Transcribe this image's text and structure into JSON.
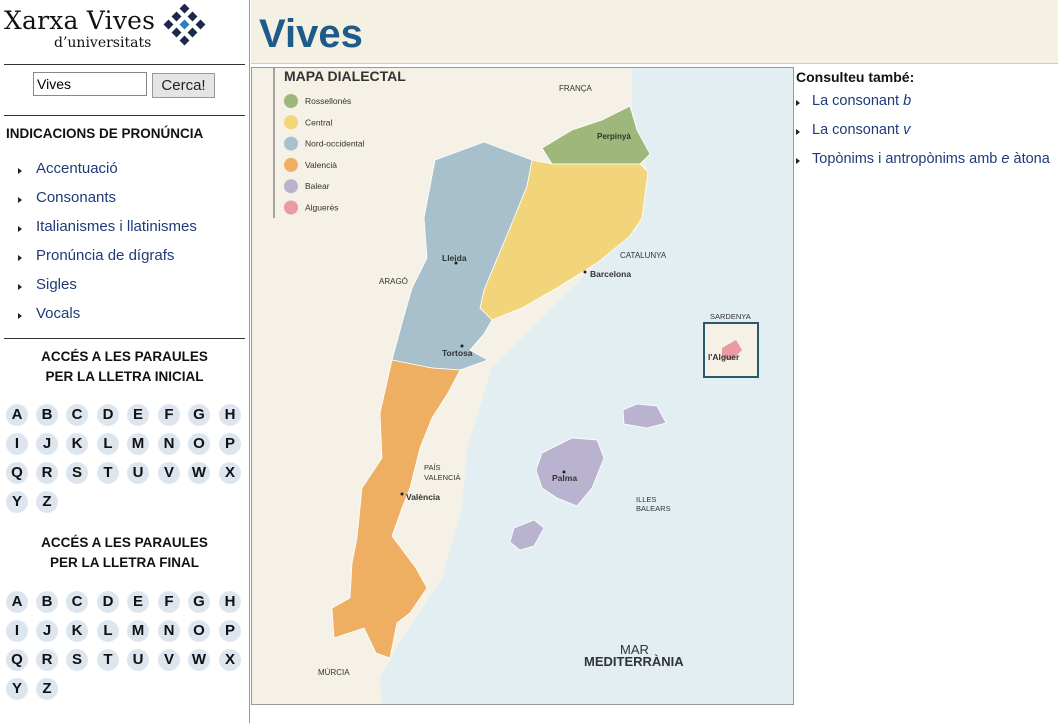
{
  "logo": {
    "line1": "Xarxa Vives",
    "line2": "d’universitats"
  },
  "search": {
    "value": "Vives",
    "button_label": "Cerca!"
  },
  "pronunciation": {
    "title": "INDICACIONS DE PRONÚNCIA",
    "items": [
      "Accentuació",
      "Consonants",
      "Italianismes i llatinismes",
      "Pronúncia de dígrafs",
      "Sigles",
      "Vocals"
    ]
  },
  "initial_letter": {
    "title_line1": "ACCÉS A LES PARAULES",
    "title_line2": "PER LA LLETRA INICIAL",
    "letters": [
      "A",
      "B",
      "C",
      "D",
      "E",
      "F",
      "G",
      "H",
      "I",
      "J",
      "K",
      "L",
      "M",
      "N",
      "O",
      "P",
      "Q",
      "R",
      "S",
      "T",
      "U",
      "V",
      "W",
      "X",
      "Y",
      "Z"
    ]
  },
  "final_letter": {
    "title_line1": "ACCÉS A LES PARAULES",
    "title_line2": "PER LA LLETRA FINAL",
    "letters": [
      "A",
      "B",
      "C",
      "D",
      "E",
      "F",
      "G",
      "H",
      "I",
      "J",
      "K",
      "L",
      "M",
      "N",
      "O",
      "P",
      "Q",
      "R",
      "S",
      "T",
      "U",
      "V",
      "W",
      "X",
      "Y",
      "Z"
    ]
  },
  "page": {
    "title": "Vives"
  },
  "map": {
    "title": "MAPA DIALECTAL",
    "legend": [
      {
        "label": "Rossellonès",
        "color": "#9db87a"
      },
      {
        "label": "Central",
        "color": "#f2d57a"
      },
      {
        "label": "Nord-occidental",
        "color": "#a7c0cc"
      },
      {
        "label": "Valencià",
        "color": "#eeaf63"
      },
      {
        "label": "Balear",
        "color": "#b9b3cf"
      },
      {
        "label": "Alguerès",
        "color": "#e99aa3"
      }
    ],
    "labels": {
      "franca": "FRANÇA",
      "perpinya": "Perpinyà",
      "catalunya": "CATALUNYA",
      "barcelona": "Barcelona",
      "lleida": "Lleida",
      "arago": "ARAGÓ",
      "tortosa": "Tortosa",
      "sardenya": "SARDENYA",
      "alguer": "l'Alguer",
      "pais_valencia_1": "PAÍS",
      "pais_valencia_2": "VALENCIÀ",
      "valencia": "València",
      "palma": "Palma",
      "illes_1": "ILLES",
      "illes_2": "BALEARS",
      "murcia": "MÚRCIA",
      "mar": "MAR",
      "mediterrania": "MEDITERRÀNIA"
    },
    "sea_color": "#e3eef3",
    "land_color": "#f5f1e6"
  },
  "see_also": {
    "title": "Consulteu també:",
    "items": [
      {
        "text": "La consonant ",
        "italic": "b",
        "after": ""
      },
      {
        "text": "La consonant ",
        "italic": "v",
        "after": ""
      },
      {
        "text": "Topònims i antropònims amb ",
        "italic": "e",
        "after": " àtona"
      }
    ]
  }
}
